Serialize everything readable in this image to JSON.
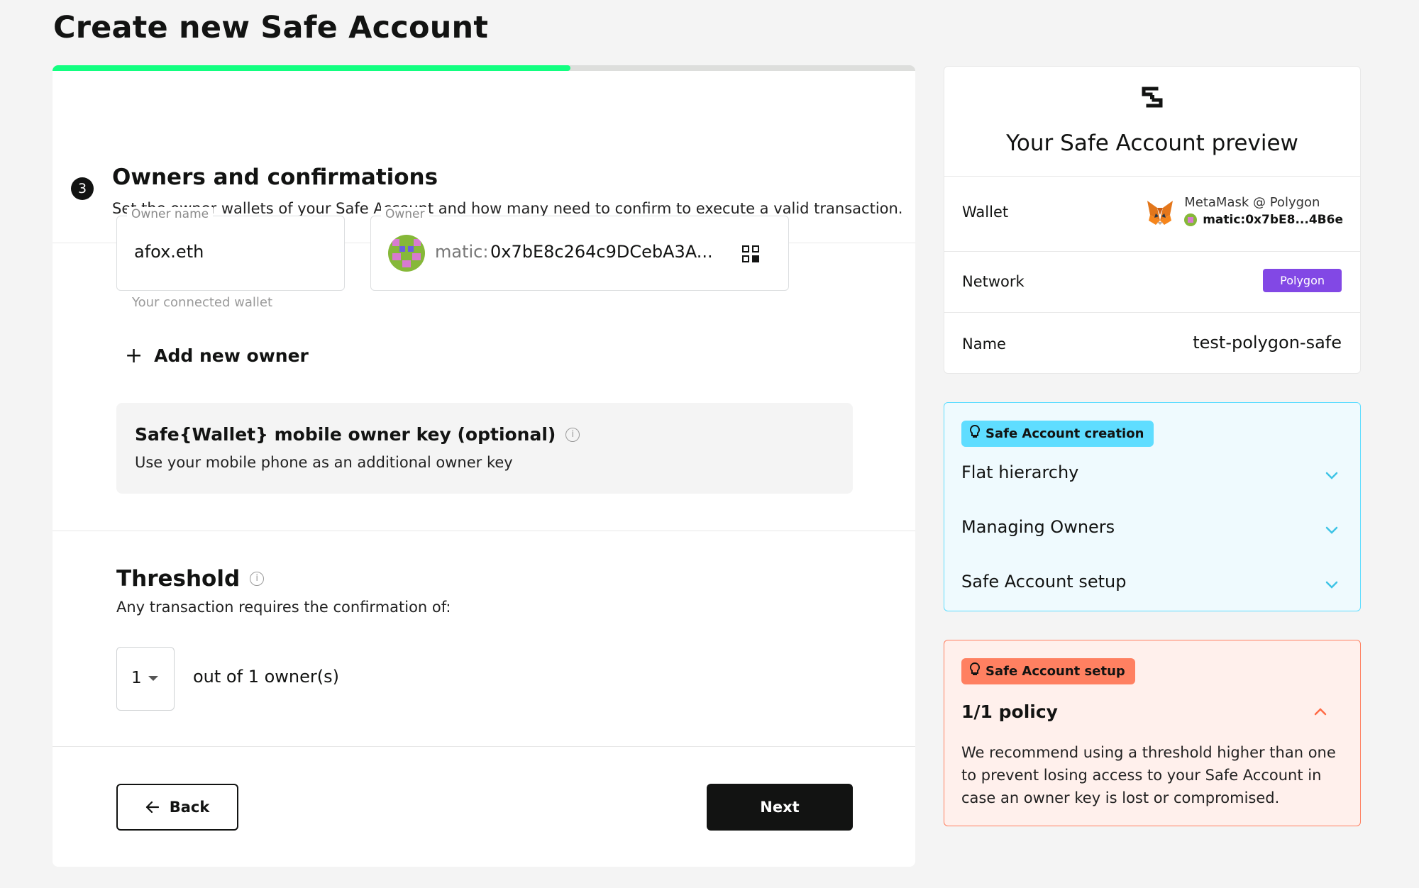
{
  "page": {
    "title": "Create new Safe Account"
  },
  "progress": {
    "fraction": 0.6
  },
  "step": {
    "number": "3",
    "title": "Owners and confirmations",
    "subtitle": "Set the owner wallets of your Safe Account and how many need to confirm to execute a valid transaction."
  },
  "owner_form": {
    "name_label": "Owner name",
    "name_value": "afox.eth",
    "name_helper": "Your connected wallet",
    "address_label": "Owner",
    "address_prefix": "matic:",
    "address_value": "0x7bE8c264c9DCebA3A...",
    "add_owner_label": "Add new owner"
  },
  "mobile_key": {
    "title": "Safe{Wallet} mobile owner key (optional)",
    "subtitle": "Use your mobile phone as an additional owner key"
  },
  "threshold": {
    "title": "Threshold",
    "subtitle": "Any transaction requires the confirmation of:",
    "selected": "1",
    "out_of": "out of 1 owner(s)"
  },
  "nav": {
    "back_label": "Back",
    "next_label": "Next"
  },
  "preview": {
    "title": "Your Safe Account preview",
    "wallet_label": "Wallet",
    "wallet_name": "MetaMask @ Polygon",
    "wallet_address": "matic:0x7bE8...4B6e",
    "network_label": "Network",
    "network_value": "Polygon",
    "network_color": "#8248e5",
    "name_label": "Name",
    "name_value": "test-polygon-safe"
  },
  "creation_tips": {
    "badge": "Safe Account creation",
    "items": [
      "Flat hierarchy",
      "Managing Owners",
      "Safe Account setup"
    ]
  },
  "setup_tips": {
    "badge": "Safe Account setup",
    "title": "1/1 policy",
    "text": "We recommend using a threshold higher than one to prevent losing access to your Safe Account in case an owner key is lost or compromised."
  },
  "colors": {
    "accent_green": "#12ff80",
    "info_blue": "#5fddff",
    "warning_red": "#ff8061",
    "dark": "#121312"
  }
}
